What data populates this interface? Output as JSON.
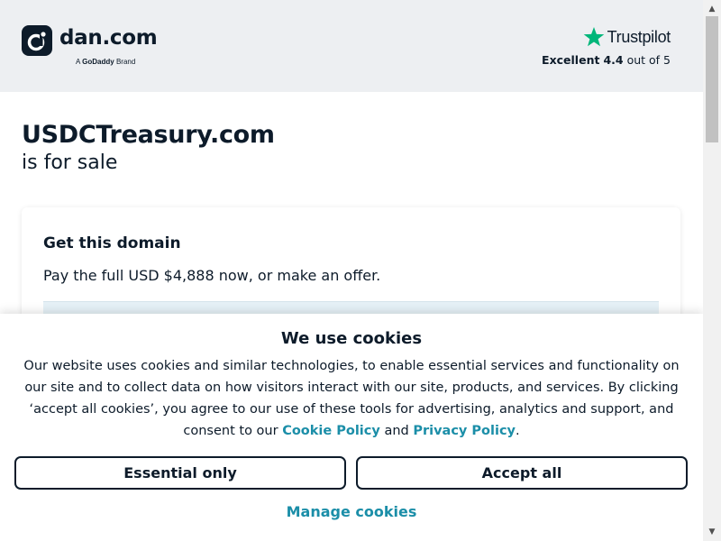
{
  "header": {
    "logo_text": "dan.com",
    "logo_tagline_prefix": "A",
    "logo_tagline_brand": "GoDaddy",
    "logo_tagline_suffix": "Brand",
    "trustpilot": {
      "brand": "Trustpilot",
      "rating_label": "Excellent",
      "rating_value": "4.4",
      "rating_suffix": "out of 5",
      "star_color": "#00b67a"
    }
  },
  "main": {
    "domain": "USDCTreasury.com",
    "subtitle": "is for sale"
  },
  "card": {
    "title": "Get this domain",
    "text": "Pay the full USD $4,888 now, or make an offer."
  },
  "cookie_banner": {
    "title": "We use cookies",
    "body": "Our website uses cookies and similar technologies, to enable essential services and functionality on our site and to collect data on how visitors interact with our site, products, and services. By clicking ‘accept all cookies’, you agree to our use of these tools for advertising, analytics and support, and consent to our",
    "cookie_policy_link": "Cookie Policy",
    "and_text": "and",
    "privacy_policy_link": "Privacy Policy",
    "period": ".",
    "essential_button": "Essential only",
    "accept_button": "Accept all",
    "manage_link": "Manage cookies"
  },
  "scrollbar": {
    "up_icon": "triangle-up",
    "down_icon": "triangle-down"
  },
  "colors": {
    "brand_dark": "#0d1b2a",
    "link_teal": "#1b8ea8",
    "header_bg": "#edeff2"
  }
}
